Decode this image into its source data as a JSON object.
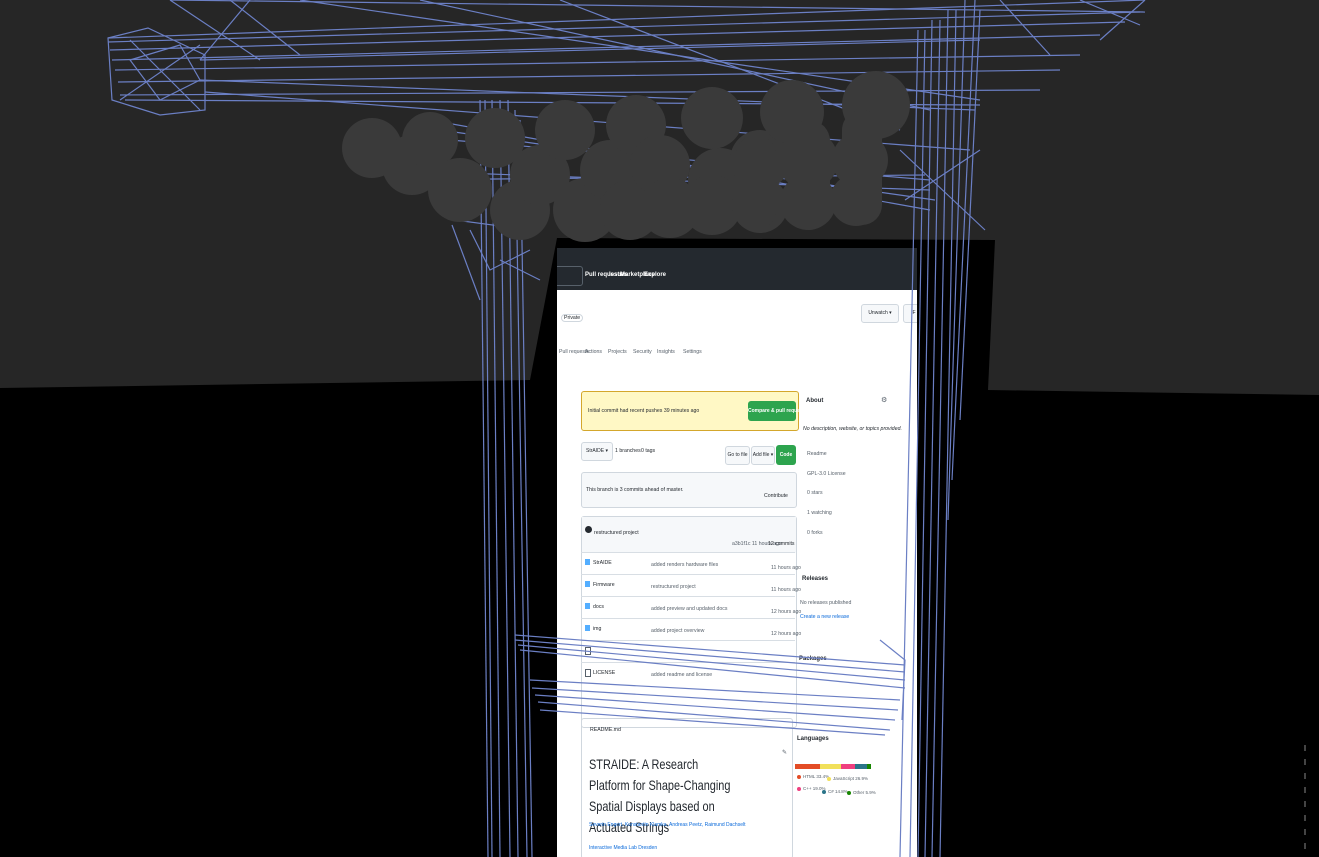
{
  "colors": {
    "wall": "#262626",
    "floor": "#000000",
    "wireframe": "#6b7fc4",
    "spheres": "#3a3a3a",
    "topbar": "#24292f",
    "banner": "#fff8c5",
    "primary_button": "#2da44e",
    "link": "#0969da",
    "folder": "#54aeff",
    "languages": [
      "#e34c26",
      "#f1e05a",
      "#ef3f7f",
      "#2b7489",
      "#178600"
    ]
  },
  "topbar": {
    "nav": [
      "Pull requests",
      "Issues",
      "Marketplace",
      "Explore"
    ]
  },
  "repo": {
    "visibility": "Private",
    "unwatch_label": "Unwatch",
    "fork_label": "F",
    "tabs": [
      "Pull requests",
      "Actions",
      "Projects",
      "Security",
      "Insights",
      "Settings"
    ]
  },
  "banner": {
    "text": "Initial commit had recent pushes 39 minutes ago",
    "button": "Compare & pull request"
  },
  "branch_bar": {
    "branch": "StrAIDE",
    "branches": "1 branches",
    "tags": "0 tags",
    "goto_file": "Go to file",
    "add_file": "Add file",
    "code": "Code"
  },
  "notice": {
    "text": "This branch is 3 commits ahead of master.",
    "contribute": "Contribute"
  },
  "commit": {
    "message": "restructured project",
    "meta": "a3b1f1c 11 hours ago",
    "count": "12 commits"
  },
  "files": [
    {
      "name": "StrAIDE",
      "type": "folder",
      "message": "added renders hardware files",
      "time": "11 hours ago"
    },
    {
      "name": "Firmware",
      "type": "folder",
      "message": "restructured project",
      "time": "11 hours ago"
    },
    {
      "name": "docs",
      "type": "folder",
      "message": "added preview and updated docs",
      "time": "12 hours ago"
    },
    {
      "name": "img",
      "type": "folder",
      "message": "added project overview",
      "time": "12 hours ago"
    },
    {
      "name": "",
      "type": "file",
      "message": "",
      "time": ""
    },
    {
      "name": "LICENSE",
      "type": "file",
      "message": "added readme and license",
      "time": ""
    }
  ],
  "readme": {
    "label": "README.md",
    "title": "STRAIDE: A Research Platform for Shape-Changing Spatial Displays based on Actuated Strings",
    "authors": "Severin Engert, Konstantin Klamka, Andreas Peetz, Raimund Dachselt",
    "affiliation": "Interactive Media Lab Dresden"
  },
  "about": {
    "heading": "About",
    "description": "No description, website, or topics provided.",
    "items": [
      "Readme",
      "GPL-3.0 License",
      "0 stars",
      "1 watching",
      "0 forks"
    ]
  },
  "releases": {
    "heading": "Releases",
    "none": "No releases published",
    "link": "Create a new release"
  },
  "packages": {
    "heading": "Packages"
  },
  "languages": {
    "heading": "Languages",
    "items": [
      "HTML 33.4%",
      "JavaScript 26.9%",
      "C++ 19.0%",
      "C# 14.8%",
      "Other 5.9%"
    ],
    "shares": [
      33.4,
      26.9,
      19.0,
      14.8,
      5.9
    ]
  }
}
